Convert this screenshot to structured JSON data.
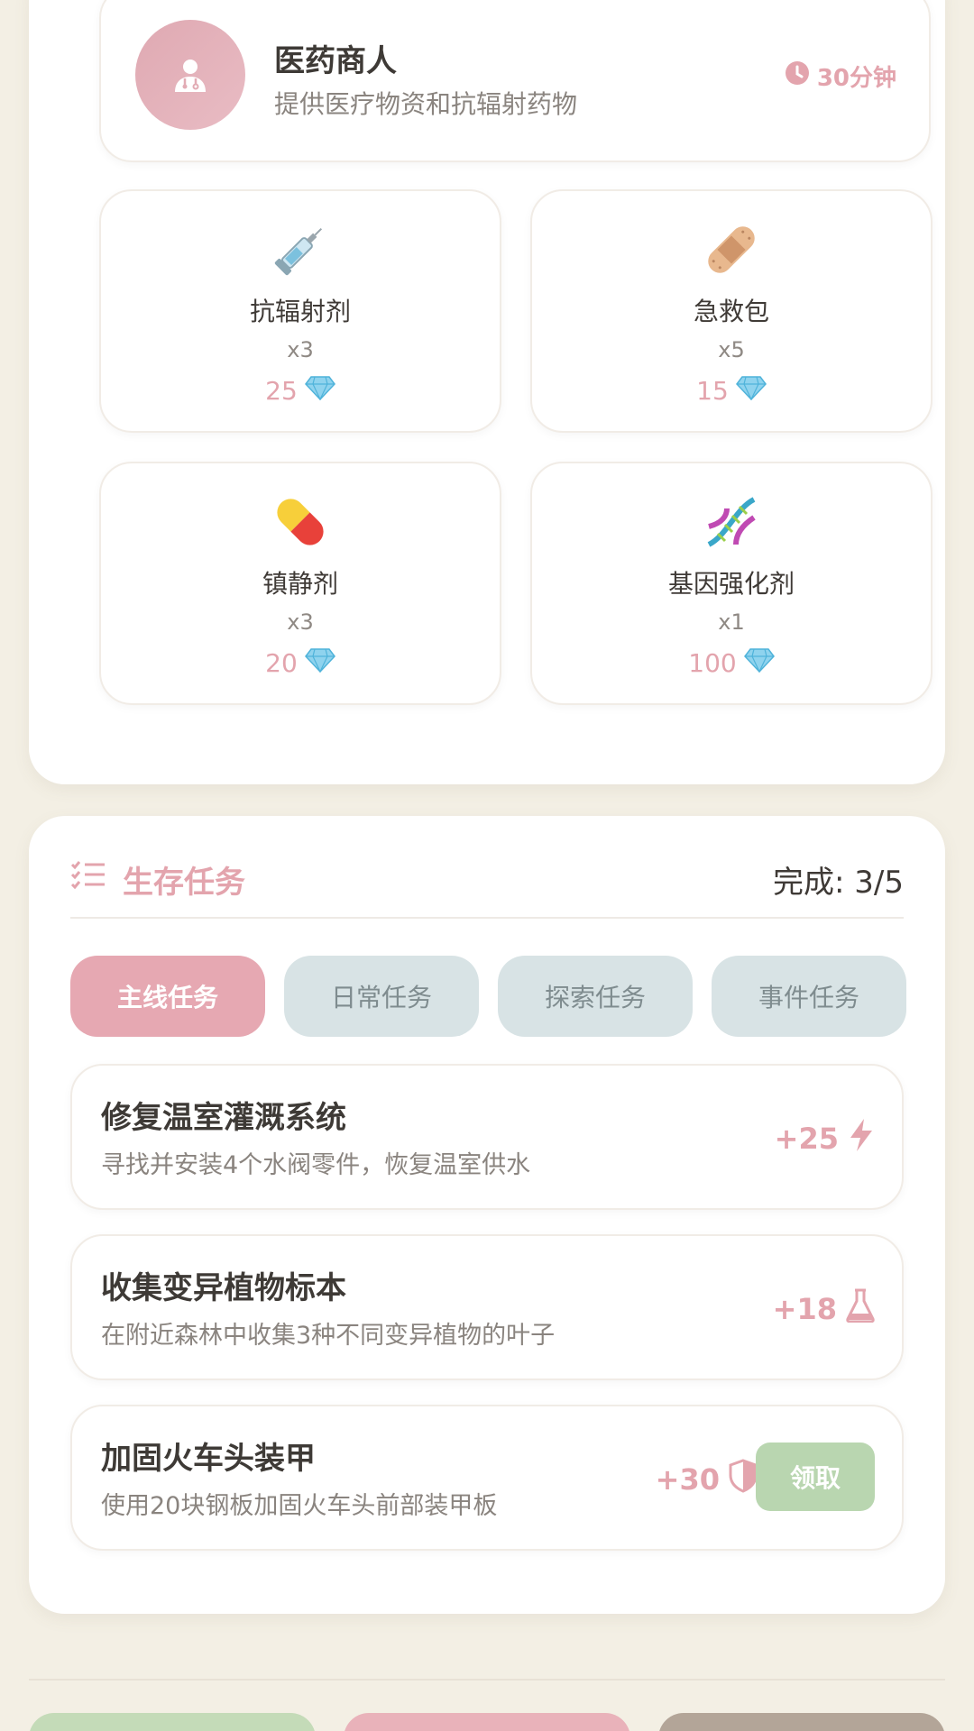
{
  "merchant": {
    "name": "医药商人",
    "description": "提供医疗物资和抗辐射药物",
    "timer": "30分钟"
  },
  "items": [
    {
      "icon": "syringe-icon",
      "name": "抗辐射剂",
      "qty": "x3",
      "price": "25"
    },
    {
      "icon": "bandage-icon",
      "name": "急救包",
      "qty": "x5",
      "price": "15"
    },
    {
      "icon": "pill-icon",
      "name": "镇静剂",
      "qty": "x3",
      "price": "20"
    },
    {
      "icon": "dna-icon",
      "name": "基因强化剂",
      "qty": "x1",
      "price": "100"
    }
  ],
  "tasks": {
    "title": "生存任务",
    "progress": "完成: 3/5",
    "tabs": [
      {
        "label": "主线任务",
        "active": true
      },
      {
        "label": "日常任务",
        "active": false
      },
      {
        "label": "探索任务",
        "active": false
      },
      {
        "label": "事件任务",
        "active": false
      }
    ],
    "list": [
      {
        "title": "修复温室灌溉系统",
        "desc": "寻找并安装4个水阀零件，恢复温室供水",
        "reward": "+25",
        "reward_icon": "lightning-icon"
      },
      {
        "title": "收集变异植物标本",
        "desc": "在附近森林中收集3种不同变异植物的叶子",
        "reward": "+18",
        "reward_icon": "flask-icon"
      },
      {
        "title": "加固火车头装甲",
        "desc": "使用20块钢板加固火车头前部装甲板",
        "reward": "+30",
        "reward_icon": "shield-icon",
        "claim_label": "领取"
      }
    ]
  },
  "colors": {
    "accent_pink": "#e3a4ad",
    "tab_inactive": "#d8e3e5",
    "claim_green": "#b9d6b0",
    "background": "#f3efe4"
  }
}
